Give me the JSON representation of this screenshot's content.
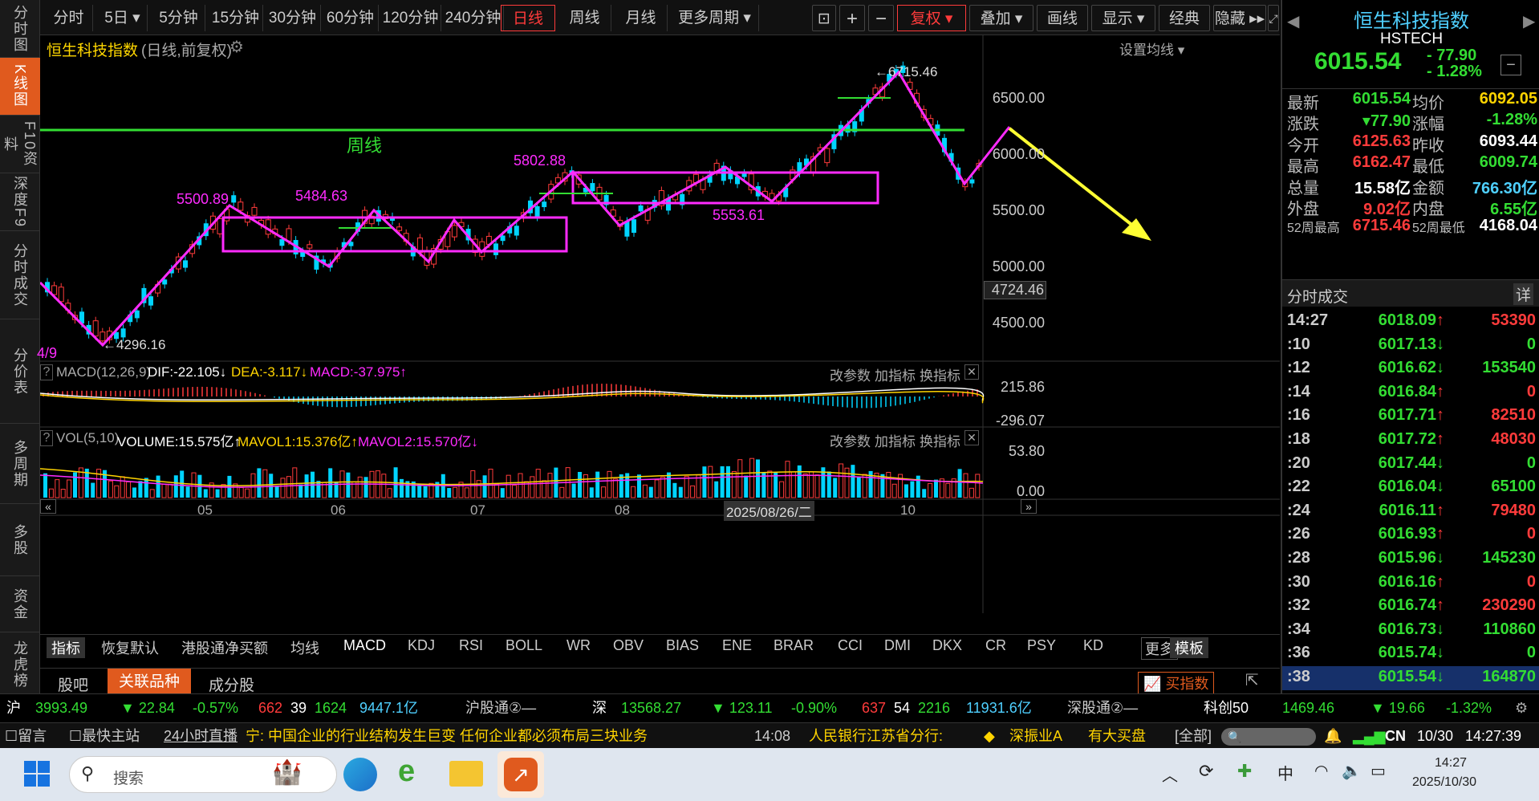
{
  "left_nav": [
    {
      "label": "分时图",
      "active": false
    },
    {
      "label": "K线图",
      "active": true
    },
    {
      "label": "F10资料",
      "active": false
    },
    {
      "label": "深度F9",
      "active": false
    },
    {
      "label": "分时成交",
      "active": false
    },
    {
      "label": "分价表",
      "active": false
    },
    {
      "label": "多周期",
      "active": false
    },
    {
      "label": "多股",
      "active": false
    },
    {
      "label": "资金",
      "active": false
    },
    {
      "label": "龙虎榜",
      "active": false
    }
  ],
  "toolbar": {
    "periods": [
      "分时",
      "5日 ▾",
      "5分钟",
      "15分钟",
      "30分钟",
      "60分钟",
      "120分钟",
      "240分钟",
      "日线",
      "周线",
      "月线",
      "更多周期 ▾"
    ],
    "active_period": "日线",
    "right": [
      "复权 ▾",
      "叠加 ▾",
      "画线",
      "显示 ▾",
      "经典",
      "隐藏 ▸▸"
    ],
    "icons": [
      "lock-icon",
      "plus-icon",
      "minus-icon"
    ]
  },
  "chart_header": {
    "name": "恒生科技指数",
    "mode": "(日线,前复权)",
    "ma_setting": "设置均线 ▾"
  },
  "y_axis": [
    "6500.00",
    "6000.00",
    "5500.00",
    "5000.00",
    "4500.00"
  ],
  "y_current": "4724.46",
  "annotations": {
    "weekly_line": "周线",
    "peaks": [
      "5500.89",
      "5484.63",
      "5802.88",
      "6715.46"
    ],
    "troughs": [
      "4296.16",
      "5553.61"
    ],
    "start_date": "4/9"
  },
  "macd": {
    "name": "MACD(12,26,9)",
    "dif": "DIF:-22.105↓",
    "dea": "DEA:-3.117↓",
    "macd": "MACD:-37.975↑",
    "top": "215.86",
    "bottom": "-296.07"
  },
  "vol": {
    "name": "VOL(5,10)",
    "volume": "VOLUME:15.575亿↑",
    "mavol1": "MAVOL1:15.376亿↑",
    "mavol2": "MAVOL2:15.570亿↓",
    "top": "53.80",
    "bottom": "0.00"
  },
  "panel_actions": [
    "改参数",
    "加指标",
    "换指标"
  ],
  "x_axis": [
    "05",
    "06",
    "07",
    "08",
    "2025/08/26/二",
    "10"
  ],
  "indicator_tabs": [
    "指标",
    "恢复默认",
    "港股通净买额",
    "均线",
    "MACD",
    "KDJ",
    "RSI",
    "BOLL",
    "WR",
    "OBV",
    "BIAS",
    "ENE",
    "BRAR",
    "CCI",
    "DMI",
    "DKX",
    "CR",
    "PSY",
    "KD",
    "更多",
    "模板"
  ],
  "active_indicator": "MACD",
  "sub_tabs": [
    "股吧",
    "关联品种",
    "成分股"
  ],
  "active_sub_tab": "关联品种",
  "buy_index": "买指数",
  "quote": {
    "name": "恒生科技指数",
    "code": "HSTECH",
    "price": "6015.54",
    "change": "- 77.90",
    "pct": "- 1.28%",
    "rows": [
      [
        "最新",
        "6015.54",
        "均价",
        "6092.05"
      ],
      [
        "涨跌",
        "▾77.90",
        "涨幅",
        "-1.28%"
      ],
      [
        "今开",
        "6125.63",
        "昨收",
        "6093.44"
      ],
      [
        "最高",
        "6162.47",
        "最低",
        "6009.74"
      ],
      [
        "总量",
        "15.58亿",
        "金额",
        "766.30亿"
      ],
      [
        "外盘",
        "9.02亿",
        "内盘",
        "6.55亿"
      ],
      [
        "52周最高",
        "6715.46",
        "52周最低",
        "4168.04"
      ]
    ]
  },
  "ticks_title": "分时成交",
  "ticks_detail": "详",
  "ticks": [
    [
      "14:27",
      "6018.09",
      "↑",
      "53390"
    ],
    [
      ":10",
      "6017.13",
      "↓",
      "0"
    ],
    [
      ":12",
      "6016.62",
      "↓",
      "153540"
    ],
    [
      ":14",
      "6016.84",
      "↑",
      "0"
    ],
    [
      ":16",
      "6017.71",
      "↑",
      "82510"
    ],
    [
      ":18",
      "6017.72",
      "↑",
      "48030"
    ],
    [
      ":20",
      "6017.44",
      "↓",
      "0"
    ],
    [
      ":22",
      "6016.04",
      "↓",
      "65100"
    ],
    [
      ":24",
      "6016.11",
      "↑",
      "79480"
    ],
    [
      ":26",
      "6016.93",
      "↑",
      "0"
    ],
    [
      ":28",
      "6015.96",
      "↓",
      "145230"
    ],
    [
      ":30",
      "6016.16",
      "↑",
      "0"
    ],
    [
      ":32",
      "6016.74",
      "↑",
      "230290"
    ],
    [
      ":34",
      "6016.73",
      "↓",
      "110860"
    ],
    [
      ":36",
      "6015.74",
      "↓",
      "0"
    ],
    [
      ":38",
      "6015.54",
      "↓",
      "164870"
    ]
  ],
  "market_bar": {
    "sh_label": "沪",
    "sh_value": "3993.49",
    "sh_change": "▼ 22.84",
    "sh_pct": "-0.57%",
    "sh_up": "662",
    "sh_flat": "39",
    "sh_down": "1624",
    "sh_amount": "9447.1亿",
    "hgt": "沪股通②—",
    "sz_label": "深",
    "sz_value": "13568.27",
    "sz_change": "▼ 123.11",
    "sz_pct": "-0.90%",
    "sz_up": "637",
    "sz_flat": "54",
    "sz_down": "2216",
    "sz_amount": "11931.6亿",
    "sgt": "深股通②—",
    "kc_label": "科创50",
    "kc_value": "1469.46",
    "kc_change": "▼ 19.66",
    "kc_pct": "-1.32%"
  },
  "news_bar": {
    "msg": "留言",
    "home": "最快主站",
    "live": "24小时直播",
    "headline": "宁: 中国企业的行业结构发生巨变 任何企业都必须布局三块业务",
    "time": "14:08",
    "news2": "人民银行江苏省分行:",
    "alert": "深振业A",
    "alert2": "有大买盘",
    "all": "[全部]",
    "lang": "CN",
    "date": "10/30",
    "clock": "14:27:39"
  },
  "taskbar": {
    "search": "搜索",
    "ime": "中",
    "time": "14:27",
    "date": "2025/10/30"
  },
  "colors": {
    "up": "#ff3b3b",
    "down": "#00d4ff",
    "pink": "#ff2bff",
    "green": "#33dd33",
    "yellow": "#ffff33",
    "accent": "#e05a1e"
  }
}
